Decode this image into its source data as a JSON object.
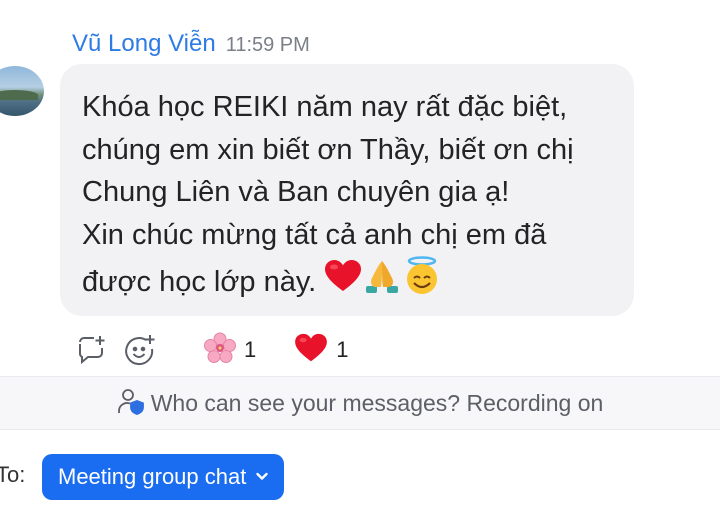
{
  "message": {
    "sender": "Vũ Long Viễn",
    "time": "11:59 PM",
    "lines": [
      "Khóa học REIKI năm nay rất đặc biệt,",
      "chúng em xin biết ơn Thầy, biết ơn chị",
      "Chung Liên và Ban chuyên gia ạ!",
      "Xin chúc mừng tất cả anh chị em đã",
      "được học lớp này."
    ],
    "emojis": [
      "red-heart",
      "folded-hands",
      "smiling-face-with-halo"
    ]
  },
  "actions": {
    "icons": [
      "reply-thread-icon",
      "add-reaction-icon"
    ]
  },
  "reactions": [
    {
      "emoji": "cherry-blossom",
      "count": "1"
    },
    {
      "emoji": "red-heart",
      "count": "1"
    }
  ],
  "info_bar": {
    "text": "Who can see your messages? Recording on"
  },
  "composer": {
    "to_label": "To:",
    "destination": "Meeting group chat"
  },
  "colors": {
    "sender_name": "#2d7be5",
    "bubble_bg": "#f2f2f5",
    "button_bg": "#1a6df0"
  }
}
